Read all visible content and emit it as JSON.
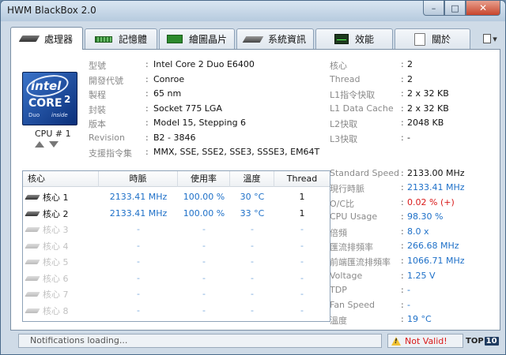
{
  "window": {
    "title": "HWM BlackBox 2.0",
    "min_glyph": "–",
    "max_glyph": "□",
    "close_glyph": "✕"
  },
  "tabs": [
    {
      "label": "處理器",
      "icon": "cpu-chip-icon",
      "active": true
    },
    {
      "label": "記憶體",
      "icon": "memory-icon"
    },
    {
      "label": "繪圖晶片",
      "icon": "gpu-icon"
    },
    {
      "label": "系統資訊",
      "icon": "system-icon"
    },
    {
      "label": "效能",
      "icon": "performance-icon"
    },
    {
      "label": "關於",
      "icon": "about-icon"
    }
  ],
  "tab_menu_glyph": "▾",
  "logo": {
    "brand": "intel",
    "line": "CORE",
    "number": "2",
    "sub": "Duo",
    "inside": "inside"
  },
  "cpu_selector": {
    "label": "CPU # 1"
  },
  "info_left": [
    {
      "label": "型號",
      "value": "Intel Core 2 Duo E6400"
    },
    {
      "label": "開發代號",
      "value": "Conroe"
    },
    {
      "label": "製程",
      "value": "65 nm"
    },
    {
      "label": "封裝",
      "value": "Socket 775 LGA"
    },
    {
      "label": "版本",
      "value": "Model 15, Stepping 6"
    },
    {
      "label": "Revision",
      "value": "B2 - 3846"
    },
    {
      "label": "支援指令集",
      "value": "MMX, SSE, SSE2, SSE3, SSSE3, EM64T"
    }
  ],
  "info_right_top": [
    {
      "label": "核心",
      "value": "2"
    },
    {
      "label": "Thread",
      "value": "2"
    },
    {
      "label": "L1指令快取",
      "value": "2 x 32 KB"
    },
    {
      "label": "L1 Data Cache",
      "value": "2 x 32 KB"
    },
    {
      "label": "L2快取",
      "value": "2048 KB"
    },
    {
      "label": "L3快取",
      "value": "-"
    }
  ],
  "info_right_bottom": [
    {
      "label": "Standard Speed",
      "value": "2133.00 MHz",
      "color": "dark"
    },
    {
      "label": "現行時脈",
      "value": "2133.41 MHz",
      "color": "blue"
    },
    {
      "label": "O/C比",
      "value": "0.02 % (+)",
      "color": "red"
    },
    {
      "label": "CPU Usage",
      "value": "98.30 %",
      "color": "blue"
    },
    {
      "label": "倍頻",
      "value": "8.0 x",
      "color": "blue"
    },
    {
      "label": "匯流排頻率",
      "value": "266.68 MHz",
      "color": "blue"
    },
    {
      "label": "前端匯流排頻率",
      "value": "1066.71 MHz",
      "color": "blue"
    },
    {
      "label": "Voltage",
      "value": "1.25 V",
      "color": "blue"
    },
    {
      "label": "TDP",
      "value": "-",
      "color": "blue"
    },
    {
      "label": "Fan Speed",
      "value": "-",
      "color": "blue"
    },
    {
      "label": "溫度",
      "value": "19 °C",
      "color": "blue"
    }
  ],
  "cores_table": {
    "headers": [
      "核心",
      "時脈",
      "使用率",
      "溫度",
      "Thread"
    ],
    "rows": [
      {
        "name": "核心 1",
        "clock": "2133.41 MHz",
        "usage": "100.00 %",
        "temp": "30 °C",
        "thread": "1",
        "active": true
      },
      {
        "name": "核心 2",
        "clock": "2133.41 MHz",
        "usage": "100.00 %",
        "temp": "33 °C",
        "thread": "1",
        "active": true
      },
      {
        "name": "核心 3",
        "clock": "-",
        "usage": "-",
        "temp": "-",
        "thread": "-",
        "active": false
      },
      {
        "name": "核心 4",
        "clock": "-",
        "usage": "-",
        "temp": "-",
        "thread": "-",
        "active": false
      },
      {
        "name": "核心 5",
        "clock": "-",
        "usage": "-",
        "temp": "-",
        "thread": "-",
        "active": false
      },
      {
        "name": "核心 6",
        "clock": "-",
        "usage": "-",
        "temp": "-",
        "thread": "-",
        "active": false
      },
      {
        "name": "核心 7",
        "clock": "-",
        "usage": "-",
        "temp": "-",
        "thread": "-",
        "active": false
      },
      {
        "name": "核心 8",
        "clock": "-",
        "usage": "-",
        "temp": "-",
        "thread": "-",
        "active": false
      }
    ]
  },
  "status": {
    "message": "Notifications loading...",
    "warning": "Not Valid!",
    "badge_a": "TOP",
    "badge_b": "10"
  },
  "colors": {
    "accent_blue": "#1e70c8",
    "warning_red": "#d91a1a",
    "dim_text": "#c2c2c2"
  }
}
